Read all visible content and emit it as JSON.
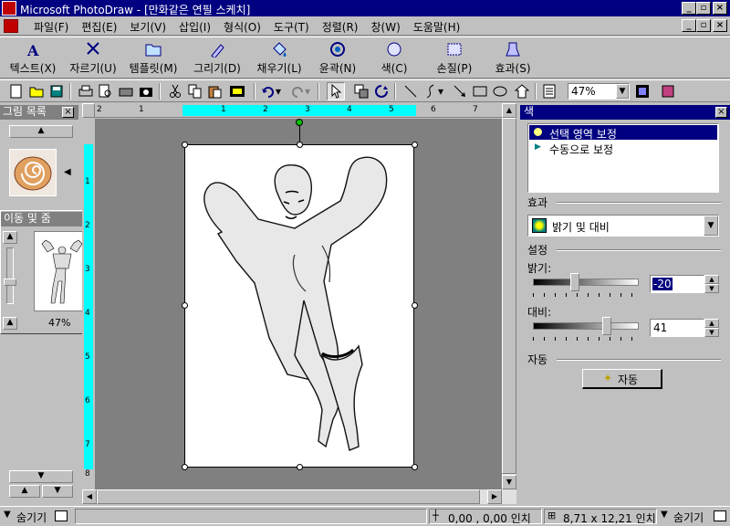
{
  "window": {
    "title": "Microsoft PhotoDraw - [만화같은 연필 스케치]"
  },
  "menu": [
    "파일(F)",
    "편집(E)",
    "보기(V)",
    "삽입(I)",
    "형식(O)",
    "도구(T)",
    "정렬(R)",
    "창(W)",
    "도움말(H)"
  ],
  "visual_menu": [
    {
      "label": "텍스트(X)",
      "icon": "text-icon"
    },
    {
      "label": "자르기(U)",
      "icon": "scissors-icon"
    },
    {
      "label": "템플릿(M)",
      "icon": "template-icon"
    },
    {
      "label": "그리기(D)",
      "icon": "draw-icon"
    },
    {
      "label": "채우기(L)",
      "icon": "fill-icon"
    },
    {
      "label": "윤곽(N)",
      "icon": "outline-icon"
    },
    {
      "label": "색(C)",
      "icon": "color-icon"
    },
    {
      "label": "손질(P)",
      "icon": "touchup-icon"
    },
    {
      "label": "효과(S)",
      "icon": "effects-icon"
    }
  ],
  "toolbar": {
    "zoom": "47%"
  },
  "picture_list": {
    "title": "그림 목록"
  },
  "pan_zoom": {
    "title": "이동 및 줌",
    "zoom": "47%"
  },
  "ruler": {
    "h_ticks": [
      "2",
      "1",
      "1",
      "2",
      "3",
      "4",
      "5",
      "6",
      "7"
    ],
    "v_ticks": [
      "1",
      "2",
      "3",
      "4",
      "5",
      "6",
      "7",
      "8"
    ]
  },
  "color_panel": {
    "title": "색",
    "options": [
      "선택 영역 보정",
      "수동으로 보정"
    ],
    "selected_option": 0,
    "effect_label": "효과",
    "effect_value": "밝기 및 대비",
    "settings_label": "설정",
    "brightness_label": "밝기:",
    "brightness_value": "-20",
    "brightness_level": 0.4,
    "contrast_label": "대비:",
    "contrast_value": "41",
    "contrast_level": 0.7,
    "auto_label": "자동",
    "auto_button": "자동"
  },
  "status": {
    "left_toggle": "숨기기",
    "position": "0,00 , 0,00 인치",
    "size": "8,71 x 12,21 인치",
    "right_toggle": "숨기기"
  },
  "colors": {
    "titlebar": "#000080",
    "ruler_highlight": "#00ffff",
    "workarea": "#808080"
  }
}
